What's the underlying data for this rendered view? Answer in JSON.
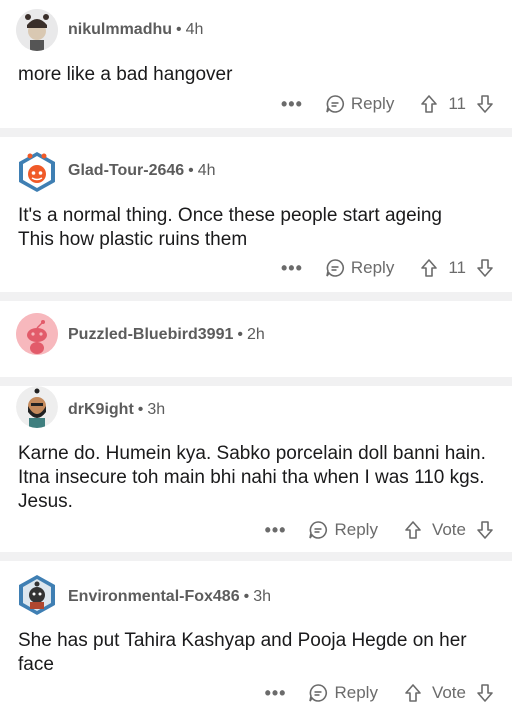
{
  "ui": {
    "more": "•••",
    "reply": "Reply"
  },
  "comments": [
    {
      "user": "nikulmmadhu",
      "time": "4h",
      "text": "more like a bad hangover",
      "score": "11"
    },
    {
      "user": "Glad-Tour-2646",
      "time": "4h",
      "text": "It's a normal thing. Once these people start ageing\nThis how plastic ruins them",
      "score": "11"
    },
    {
      "user": "Puzzled-Bluebird3991",
      "time": "2h"
    },
    {
      "user": "drK9ight",
      "time": "3h",
      "text": "Karne do. Humein kya. Sabko porcelain doll banni hain. Itna insecure toh main bhi nahi tha when I was 110 kgs. Jesus.",
      "score": "Vote"
    },
    {
      "user": "Environmental-Fox486",
      "time": "3h",
      "text": "She has put Tahira Kashyap and Pooja Hegde on her face",
      "score": "Vote"
    }
  ],
  "separator": "•",
  "colors": {
    "separator": "#f1f1f2",
    "meta": "#5c5c5c",
    "text": "#1a1a1b"
  }
}
